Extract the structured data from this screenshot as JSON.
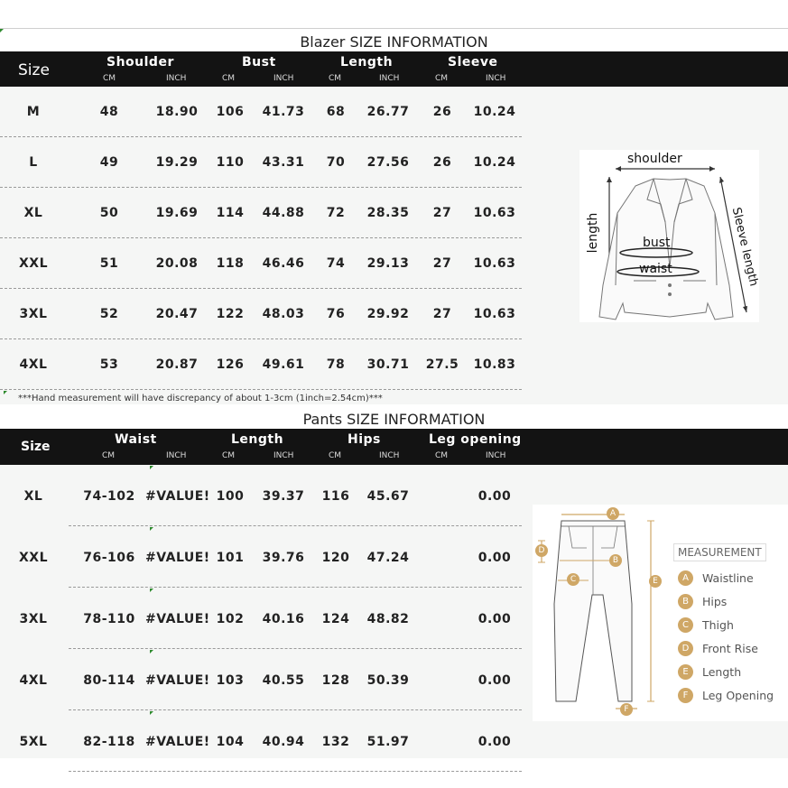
{
  "blazer": {
    "title": "Blazer SIZE INFORMATION",
    "headers": {
      "size": "Size",
      "groups": [
        "Shoulder",
        "Bust",
        "Length",
        "Sleeve"
      ],
      "cm": "CM",
      "inch": "INCH"
    },
    "rows": [
      {
        "size": "M",
        "vals": [
          "48",
          "18.90",
          "106",
          "41.73",
          "68",
          "26.77",
          "26",
          "10.24"
        ]
      },
      {
        "size": "L",
        "vals": [
          "49",
          "19.29",
          "110",
          "43.31",
          "70",
          "27.56",
          "26",
          "10.24"
        ]
      },
      {
        "size": "XL",
        "vals": [
          "50",
          "19.69",
          "114",
          "44.88",
          "72",
          "28.35",
          "27",
          "10.63"
        ]
      },
      {
        "size": "XXL",
        "vals": [
          "51",
          "20.08",
          "118",
          "46.46",
          "74",
          "29.13",
          "27",
          "10.63"
        ]
      },
      {
        "size": "3XL",
        "vals": [
          "52",
          "20.47",
          "122",
          "48.03",
          "76",
          "29.92",
          "27",
          "10.63"
        ]
      },
      {
        "size": "4XL",
        "vals": [
          "53",
          "20.87",
          "126",
          "49.61",
          "78",
          "30.71",
          "27.5",
          "10.83"
        ]
      }
    ],
    "note": "***Hand measurement will have discrepancy of about 1-3cm (1inch=2.54cm)***",
    "diagram_labels": {
      "shoulder": "shoulder",
      "length": "length",
      "bust": "bust",
      "waist": "waist",
      "sleeve": "Sleeve length"
    }
  },
  "pants": {
    "title": "Pants SIZE INFORMATION",
    "headers": {
      "size": "Size",
      "groups": [
        "Waist",
        "Length",
        "Hips",
        "Leg opening"
      ],
      "cm": "CM",
      "inch": "INCH"
    },
    "rows": [
      {
        "size": "XL",
        "vals": [
          "74-102",
          "#VALUE!",
          "100",
          "39.37",
          "116",
          "45.67",
          "",
          "0.00"
        ]
      },
      {
        "size": "XXL",
        "vals": [
          "76-106",
          "#VALUE!",
          "101",
          "39.76",
          "120",
          "47.24",
          "",
          "0.00"
        ]
      },
      {
        "size": "3XL",
        "vals": [
          "78-110",
          "#VALUE!",
          "102",
          "40.16",
          "124",
          "48.82",
          "",
          "0.00"
        ]
      },
      {
        "size": "4XL",
        "vals": [
          "80-114",
          "#VALUE!",
          "103",
          "40.55",
          "128",
          "50.39",
          "",
          "0.00"
        ]
      },
      {
        "size": "5XL",
        "vals": [
          "82-118",
          "#VALUE!",
          "104",
          "40.94",
          "132",
          "51.97",
          "",
          "0.00"
        ]
      }
    ],
    "diagram": {
      "legend_title": "MEASUREMENT",
      "letters": {
        "a": "A",
        "b": "B",
        "c": "C",
        "d": "D",
        "e": "E",
        "f": "F"
      },
      "items": [
        {
          "letter": "A",
          "label": "Waistline"
        },
        {
          "letter": "B",
          "label": "Hips"
        },
        {
          "letter": "C",
          "label": "Thigh"
        },
        {
          "letter": "D",
          "label": "Front Rise"
        },
        {
          "letter": "E",
          "label": "Length"
        },
        {
          "letter": "F",
          "label": "Leg Opening"
        }
      ]
    }
  },
  "colors": {
    "header_bg": "#131313",
    "accent": "#cfa766",
    "panel": "#f5f6f5"
  }
}
